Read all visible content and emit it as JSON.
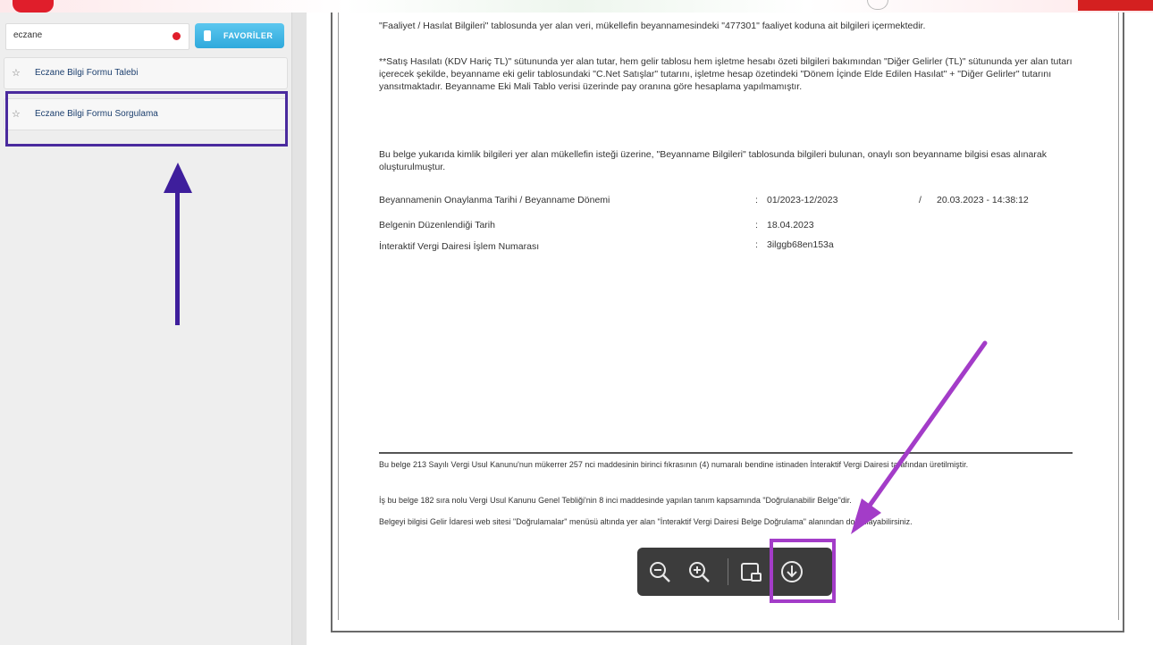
{
  "sidebar": {
    "search": {
      "value": "eczane"
    },
    "favorites_label": "FAVORİLER",
    "items": [
      {
        "label": "Eczane Bilgi Formu Talebi"
      },
      {
        "label": "Eczane Bilgi Formu Sorgulama"
      }
    ]
  },
  "document": {
    "para1": "\"Faaliyet / Hasılat Bilgileri\" tablosunda yer alan veri, mükellefin beyannamesindeki \"477301\" faaliyet koduna ait bilgileri içermektedir.",
    "para2": "**Satış Hasılatı (KDV Hariç TL)\" sütununda yer alan tutar, hem gelir tablosu hem işletme hesabı özeti bilgileri bakımından \"Diğer Gelirler (TL)\" sütununda yer alan tutarı içerecek şekilde, beyanname eki gelir tablosundaki \"C.Net Satışlar\" tutarını, işletme hesap özetindeki \"Dönem İçinde Elde Edilen Hasılat\" + \"Diğer Gelirler\" tutarını yansıtmaktadır. Beyanname Eki Mali Tablo verisi üzerinde pay oranına göre hesaplama yapılmamıştır.",
    "para3": "Bu belge yukarıda kimlik bilgileri yer alan mükellefin isteği üzerine, \"Beyanname Bilgileri\" tablosunda bilgileri bulunan, onaylı son beyanname bilgisi esas alınarak oluşturulmuştur.",
    "rows": [
      {
        "label": "Beyannamenin Onaylanma Tarihi / Beyanname Dönemi",
        "sep": ":",
        "value": "01/2023-12/2023",
        "slash": "/",
        "value2": "20.03.2023 - 14:38:12"
      },
      {
        "label": "Belgenin Düzenlendiği Tarih",
        "sep": ":",
        "value": "18.04.2023"
      },
      {
        "label": "İnteraktif Vergi Dairesi İşlem Numarası",
        "sep": ":",
        "value": "3ilggb68en153a"
      }
    ],
    "foot1": "Bu belge 213 Sayılı Vergi Usul Kanunu'nun mükerrer 257 nci maddesinin birinci fıkrasının (4) numaralı bendine istinaden İnteraktif Vergi Dairesi tarafından üretilmiştir.",
    "foot2": "İş bu belge 182 sıra nolu Vergi Usul Kanunu Genel Tebliği'nin 8 inci maddesinde yapılan tanım kapsamında \"Doğrulanabilir Belge\"dir.",
    "foot3": "Belgeyi bilgisi Gelir İdaresi web sitesi \"Doğrulamalar\" menüsü altında yer alan \"İnteraktif Vergi Dairesi Belge Doğrulama\" alanından doğrulayabilirsiniz."
  },
  "viewer_toolbar": {
    "zoom_out": "zoom-out",
    "zoom_in": "zoom-in",
    "rotate": "rotate",
    "download": "download"
  },
  "colors": {
    "sidebar_highlight": "#4a2a9e",
    "download_highlight": "#a33cc8",
    "favorites_button": "#2fa9dc",
    "brand_red": "#e01e2b"
  }
}
